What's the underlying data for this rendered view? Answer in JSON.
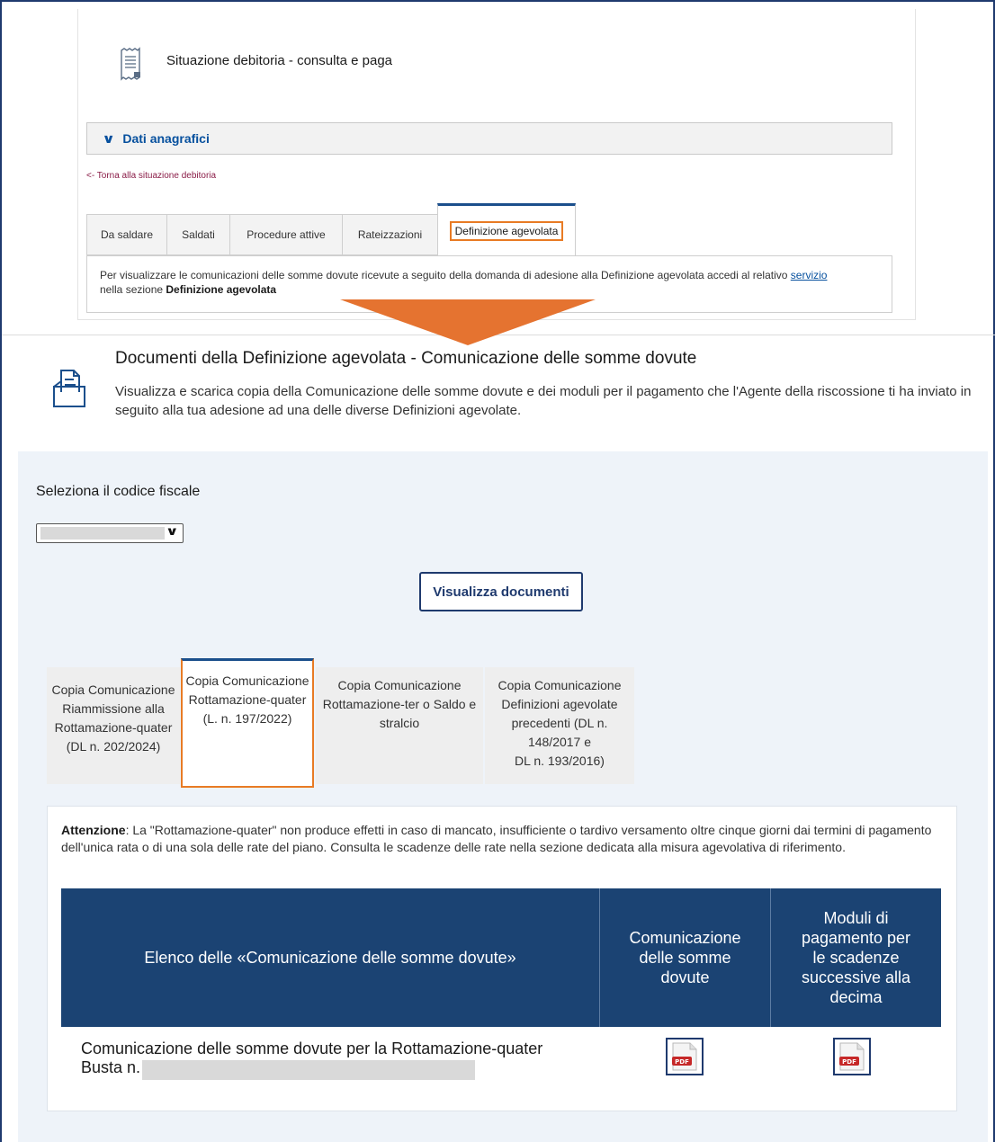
{
  "top_panel": {
    "title": "Situazione debitoria - consulta e paga",
    "accordion_label": "Dati anagrafici",
    "back_link": "<- Torna alla situazione debitoria",
    "tabs": [
      {
        "label": "Da saldare"
      },
      {
        "label": "Saldati"
      },
      {
        "label": "Procedure attive"
      },
      {
        "label": "Rateizzazioni"
      },
      {
        "label": "Definizione agevolata",
        "active": true
      }
    ],
    "tab_content_part1": "Per visualizzare le comunicazioni delle somme dovute ricevute a seguito della domanda di adesione alla Definizione agevolata accedi al relativo ",
    "tab_content_link": "servizio",
    "tab_content_part2": "nella sezione ",
    "tab_content_bold": "Definizione agevolata"
  },
  "section": {
    "title": "Documenti della Definizione agevolata - Comunicazione delle somme dovute",
    "description": "Visualizza e scarica copia della Comunicazione delle somme dovute e dei moduli per il pagamento che l'Agente della riscossione ti ha inviato in seguito alla tua adesione ad una delle diverse Definizioni agevolate."
  },
  "form": {
    "cf_label": "Seleziona il codice fiscale",
    "button_label": "Visualizza documenti"
  },
  "doc_tabs": [
    {
      "lines": [
        "Copia Comunicazione",
        "Riammissione alla",
        "Rottamazione-quater",
        "(DL n. 202/2024)"
      ]
    },
    {
      "lines": [
        "Copia Comunicazione",
        "Rottamazione-quater",
        "(L. n. 197/2022)"
      ],
      "active": true
    },
    {
      "lines": [
        "Copia Comunicazione",
        "Rottamazione-ter o Saldo e",
        "stralcio"
      ]
    },
    {
      "lines": [
        "Copia Comunicazione",
        "Definizioni agevolate",
        "precedenti (DL n.",
        "148/2017 e",
        "DL n. 193/2016)"
      ]
    }
  ],
  "warning": {
    "bold": "Attenzione",
    "text": ": La \"Rottamazione-quater\" non produce effetti in caso di mancato, insufficiente o tardivo versamento oltre cinque giorni dai termini di pagamento dell'unica rata o di una sola delle rate del piano. Consulta le scadenze delle rate nella sezione dedicata alla misura agevolativa di riferimento."
  },
  "table": {
    "headers": [
      {
        "lines": [
          "Elenco delle «Comunicazione delle somme dovute»"
        ]
      },
      {
        "lines": [
          "Comunicazione",
          "delle somme",
          "dovute"
        ]
      },
      {
        "lines": [
          "Moduli di",
          "pagamento per",
          "le scadenze",
          "successive alla",
          "decima"
        ]
      }
    ],
    "row": {
      "line1": "Comunicazione delle somme dovute per la Rottamazione-quater",
      "line2": "Busta n.",
      "pdf_icon": "pdf-icon",
      "pdf_label": "PDF"
    }
  },
  "colors": {
    "brand_blue": "#1b4373",
    "link_blue": "#06509e",
    "accent_orange": "#e87b24",
    "area_bg": "#eef3f9"
  }
}
